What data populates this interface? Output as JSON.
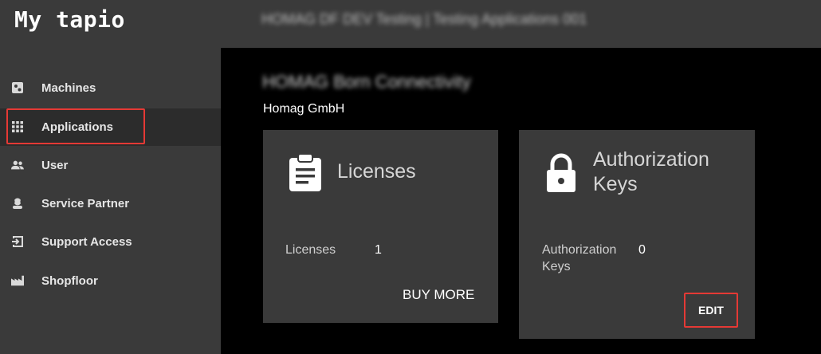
{
  "app": {
    "brand": "My tapio",
    "context_title": "HOMAG DF DEV Testing | Testing Applications 001"
  },
  "sidebar": {
    "items": [
      {
        "label": "Machines",
        "icon": "machines-icon"
      },
      {
        "label": "Applications",
        "icon": "apps-grid-icon"
      },
      {
        "label": "User",
        "icon": "users-icon"
      },
      {
        "label": "Service Partner",
        "icon": "service-partner-icon"
      },
      {
        "label": "Support Access",
        "icon": "login-icon"
      },
      {
        "label": "Shopfloor",
        "icon": "factory-icon"
      }
    ],
    "active_index": 1
  },
  "main": {
    "heading": "HOMAG Born Connectivity",
    "company": "Homag GmbH",
    "cards": [
      {
        "title": "Licenses",
        "icon": "clipboard-icon",
        "key": "Licenses",
        "value": "1",
        "action": "BUY MORE"
      },
      {
        "title_line1": "Authorization",
        "title_line2": "Keys",
        "icon": "lock-icon",
        "key_line1": "Authorization",
        "key_line2": "Keys",
        "value": "0",
        "action": "EDIT"
      }
    ]
  },
  "colors": {
    "sidebar_bg": "#3a3a3a",
    "main_bg": "#000000",
    "card_bg": "#3a3a3a",
    "highlight": "#e53935"
  }
}
